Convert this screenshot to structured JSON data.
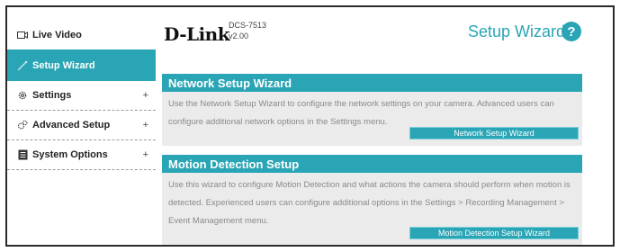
{
  "sidebar": {
    "items": [
      {
        "label": "Live Video",
        "icon": "video-camera-icon",
        "expandable": false,
        "active": false
      },
      {
        "label": "Setup Wizard",
        "icon": "wand-icon",
        "expandable": false,
        "active": true
      },
      {
        "label": "Settings",
        "icon": "gear-icon",
        "expandable": true,
        "active": false
      },
      {
        "label": "Advanced Setup",
        "icon": "gears-icon",
        "expandable": true,
        "active": false
      },
      {
        "label": "System Options",
        "icon": "document-icon",
        "expandable": true,
        "active": false
      }
    ],
    "expand_glyph": "+"
  },
  "header": {
    "logo": "D-Link",
    "model": "DCS-7513",
    "version": "v2.00",
    "title": "Setup Wizard",
    "help_glyph": "?"
  },
  "sections": {
    "network": {
      "title": "Network Setup Wizard",
      "description": "Use the Network Setup Wizard to configure the network settings on your camera. Advanced users can configure additional network options in the Settings menu.",
      "button_label": "Network Setup Wizard"
    },
    "motion": {
      "title": "Motion Detection Setup",
      "description": "Use this wizard to configure Motion Detection and what actions the camera should perform when motion is detected. Experienced users can configure additional options in the Settings > Recording Management > Event Management menu.",
      "button_label": "Motion Detection Setup Wizard"
    }
  },
  "colors": {
    "accent": "#2aa5b5",
    "section_bg": "#ebebeb",
    "body_text": "#8a8a8a"
  }
}
